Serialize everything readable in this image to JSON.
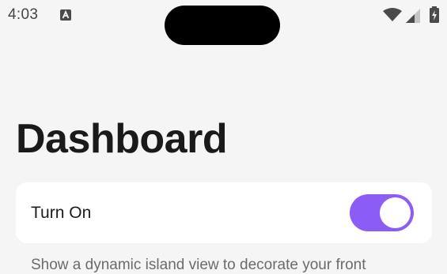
{
  "status_bar": {
    "time": "4:03",
    "icons": [
      "notification-a-icon",
      "wifi-icon",
      "cellular-signal-icon",
      "battery-charging-icon"
    ]
  },
  "page": {
    "title": "Dashboard"
  },
  "settings": {
    "toggle_label": "Turn On",
    "toggle_on": true,
    "description": "Show a dynamic island view to decorate your front"
  },
  "colors": {
    "toggle_track": "#8b5cf6",
    "background": "#f5f5f5",
    "card": "#ffffff",
    "island": "#000000"
  }
}
